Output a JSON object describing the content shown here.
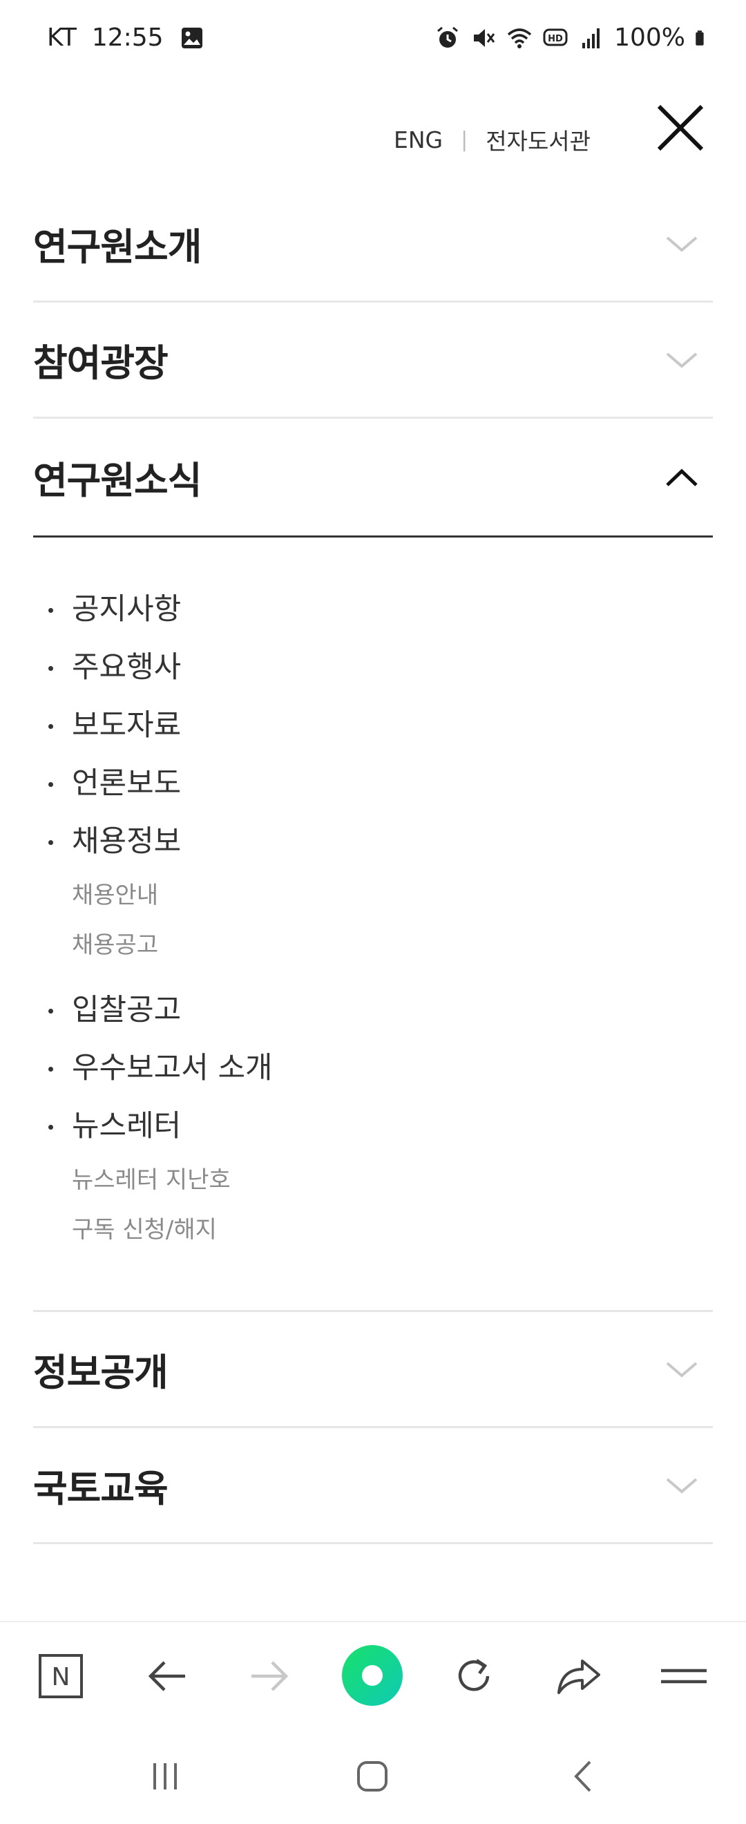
{
  "status_bar": {
    "carrier": "KT",
    "time": "12:55",
    "battery": "100%",
    "icons": [
      "image-icon",
      "alarm-icon",
      "mute-icon",
      "wifi-icon",
      "hd-icon",
      "signal-icon",
      "battery-icon"
    ]
  },
  "header": {
    "eng_label": "ENG",
    "separator": "|",
    "library_label": "전자도서관"
  },
  "menu": {
    "sections": [
      {
        "title": "연구원소개",
        "expanded": false
      },
      {
        "title": "참여광장",
        "expanded": false
      },
      {
        "title": "연구원소식",
        "expanded": true
      },
      {
        "title": "정보공개",
        "expanded": false
      },
      {
        "title": "국토교육",
        "expanded": false
      }
    ],
    "news_items": {
      "notice": "공지사항",
      "events": "주요행사",
      "press": "보도자료",
      "media": "언론보도",
      "recruit": "채용정보",
      "recruit_guide": "채용안내",
      "recruit_posting": "채용공고",
      "bid": "입찰공고",
      "best_report": "우수보고서 소개",
      "newsletter": "뉴스레터",
      "newsletter_past": "뉴스레터 지난호",
      "newsletter_subscribe": "구독 신청/해지"
    }
  },
  "toolbar": {
    "naver_label": "N",
    "accent_color": "#1ed37a"
  }
}
